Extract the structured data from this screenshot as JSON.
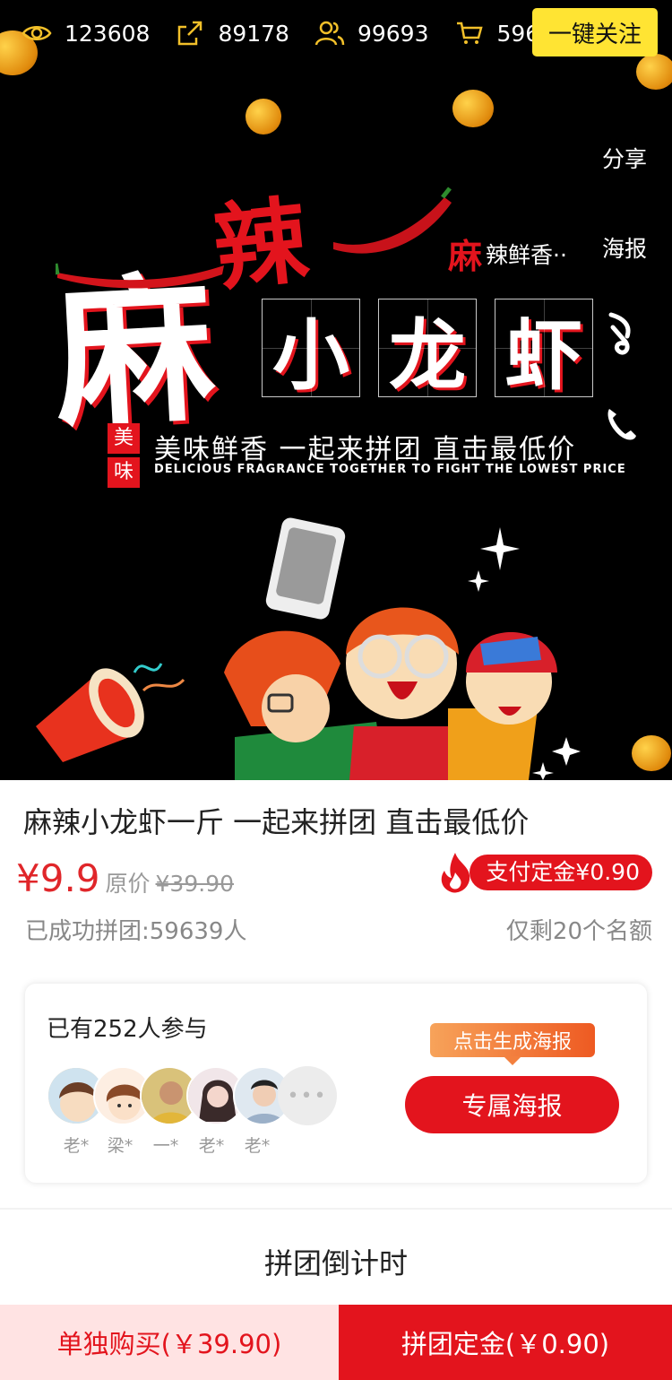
{
  "header": {
    "stats": [
      {
        "icon": "eye-icon",
        "value": "123608"
      },
      {
        "icon": "share-arrow-icon",
        "value": "89178"
      },
      {
        "icon": "users-icon",
        "value": "99693"
      },
      {
        "icon": "cart-icon",
        "value": "5963"
      }
    ],
    "follow_label": "一键关注",
    "share_label": "分享",
    "poster_label": "海报",
    "accent_color": "#ffe433"
  },
  "banner": {
    "char_la": "辣",
    "char_ma": "麻",
    "boxed_chars": [
      "小",
      "龙",
      "虾"
    ],
    "sub_highlight": "麻",
    "sub_text": "辣鲜香··",
    "badge_chars": [
      "美",
      "味"
    ],
    "slogan": "美味鲜香 一起来拼团 直击最低价",
    "slogan_en": "DELICIOUS FRAGRANCE TOGETHER TO FIGHT THE LOWEST PRICE"
  },
  "product": {
    "title": "麻辣小龙虾一斤 一起来拼团 直击最低价",
    "price": "¥9.9",
    "original_label": "原价",
    "original_price": "¥39.90",
    "deposit_label": "支付定金¥0.90",
    "success_text": "已成功拼团:59639人",
    "remaining_text": "仅剩20个名额",
    "price_color": "#e0262a"
  },
  "participants": {
    "title": "已有252人参与",
    "names": [
      "老*",
      "梁*",
      "一*",
      "老*",
      "老*"
    ],
    "more": "•••",
    "tooltip": "点击生成海报",
    "poster_button": "专属海报"
  },
  "countdown": {
    "title": "拼团倒计时"
  },
  "bottom_bar": {
    "single_buy": "单独购买(￥39.90)",
    "group_buy": "拼团定金(￥0.90)",
    "brand_color": "#e3141d"
  }
}
